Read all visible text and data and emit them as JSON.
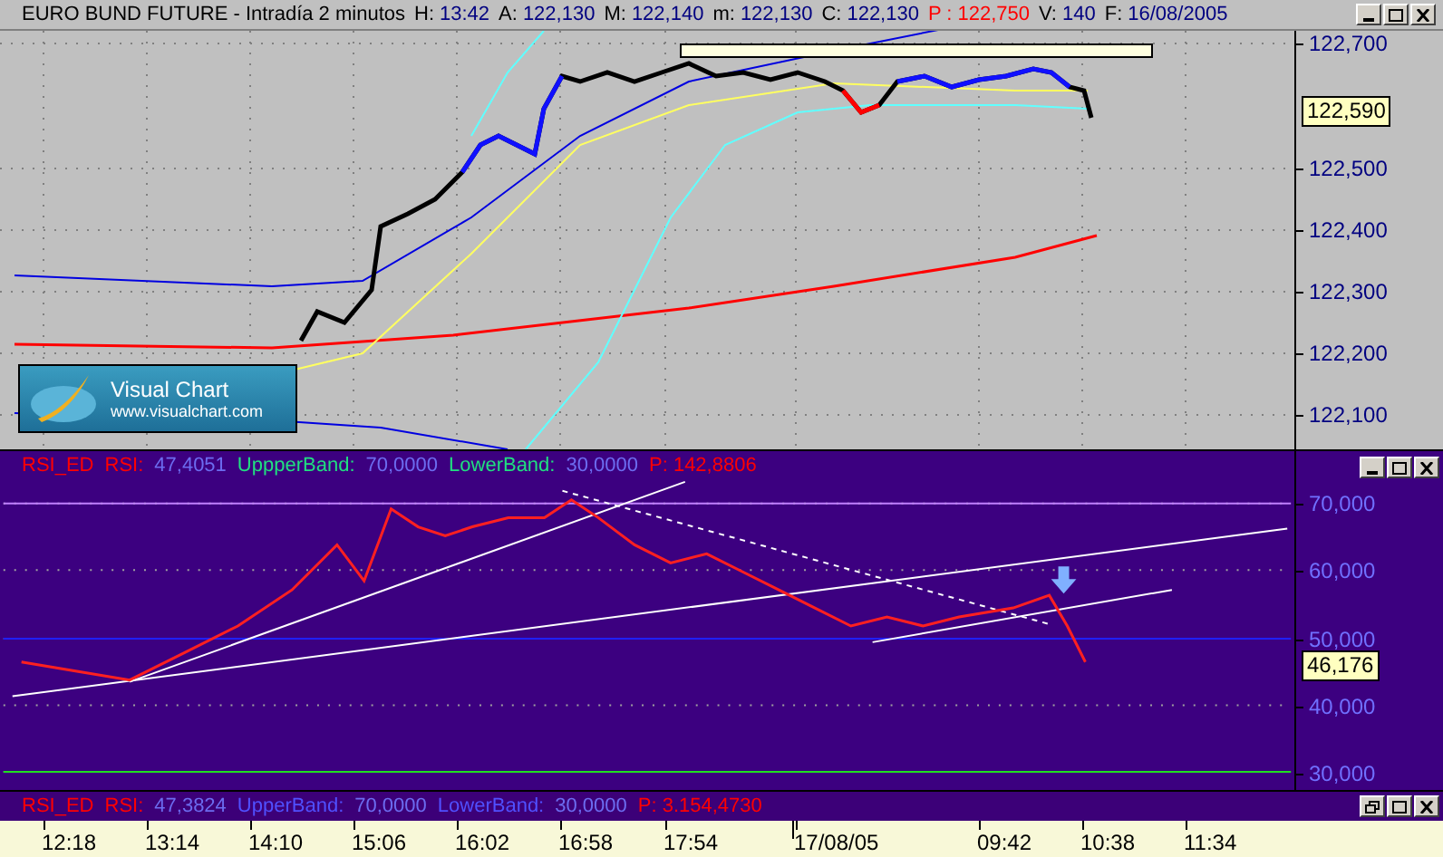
{
  "window": {
    "title": "EURO BUND FUTURE - Intradía 2 minutos",
    "fields": [
      {
        "label": "H:",
        "value": "13:42",
        "color": "#000080"
      },
      {
        "label": "A:",
        "value": "122,130",
        "color": "#000080"
      },
      {
        "label": "M:",
        "value": "122,140",
        "color": "#000080"
      },
      {
        "label": "m:",
        "value": "122,130",
        "color": "#000080"
      },
      {
        "label": "C:",
        "value": "122,130",
        "color": "#000080"
      },
      {
        "label": "P :",
        "value": "122,750",
        "color": "#ff0000"
      },
      {
        "label": "V:",
        "value": "140",
        "color": "#000080"
      },
      {
        "label": "F:",
        "value": "16/08/2005",
        "color": "#000080"
      }
    ]
  },
  "price_panel": {
    "current_value": "122,590",
    "logo": {
      "name": "Visual Chart",
      "url": "www.visualchart.com"
    },
    "axis_labels": [
      "122,700",
      "122,500",
      "122,400",
      "122,300",
      "122,200",
      "122,100"
    ]
  },
  "rsi_panel": {
    "header": [
      {
        "text": "RSI_ED",
        "color": "#ff0000"
      },
      {
        "text": "RSI:",
        "color": "#ff0000"
      },
      {
        "text": "47,4051",
        "color": "#6c6cf0"
      },
      {
        "text": "UppperBand:",
        "color": "#20e080"
      },
      {
        "text": "70,0000",
        "color": "#6c6cf0"
      },
      {
        "text": "LowerBand:",
        "color": "#20e080"
      },
      {
        "text": "30,0000",
        "color": "#6c6cf0"
      },
      {
        "text": "P: 142,8806",
        "color": "#ff0000"
      }
    ],
    "current_value": "46,176",
    "axis_labels": [
      "70,000",
      "60,000",
      "50,000",
      "40,000",
      "30,000"
    ]
  },
  "rsi_bar": {
    "header": [
      {
        "text": "RSI_ED",
        "color": "#ff0000"
      },
      {
        "text": "RSI:",
        "color": "#ff0000"
      },
      {
        "text": "47,3824",
        "color": "#6c6cf0"
      },
      {
        "text": "UpperBand:",
        "color": "#5050ff"
      },
      {
        "text": "70,0000",
        "color": "#6c6cf0"
      },
      {
        "text": "LowerBand:",
        "color": "#5050ff"
      },
      {
        "text": "30,0000",
        "color": "#6c6cf0"
      },
      {
        "text": "P: 3.154,4730",
        "color": "#ff0000"
      }
    ]
  },
  "time_axis": [
    "12:18",
    "13:14",
    "14:10",
    "15:06",
    "16:02",
    "16:58",
    "17:54",
    "17/08/05",
    "09:42",
    "10:38",
    "11:34"
  ]
}
